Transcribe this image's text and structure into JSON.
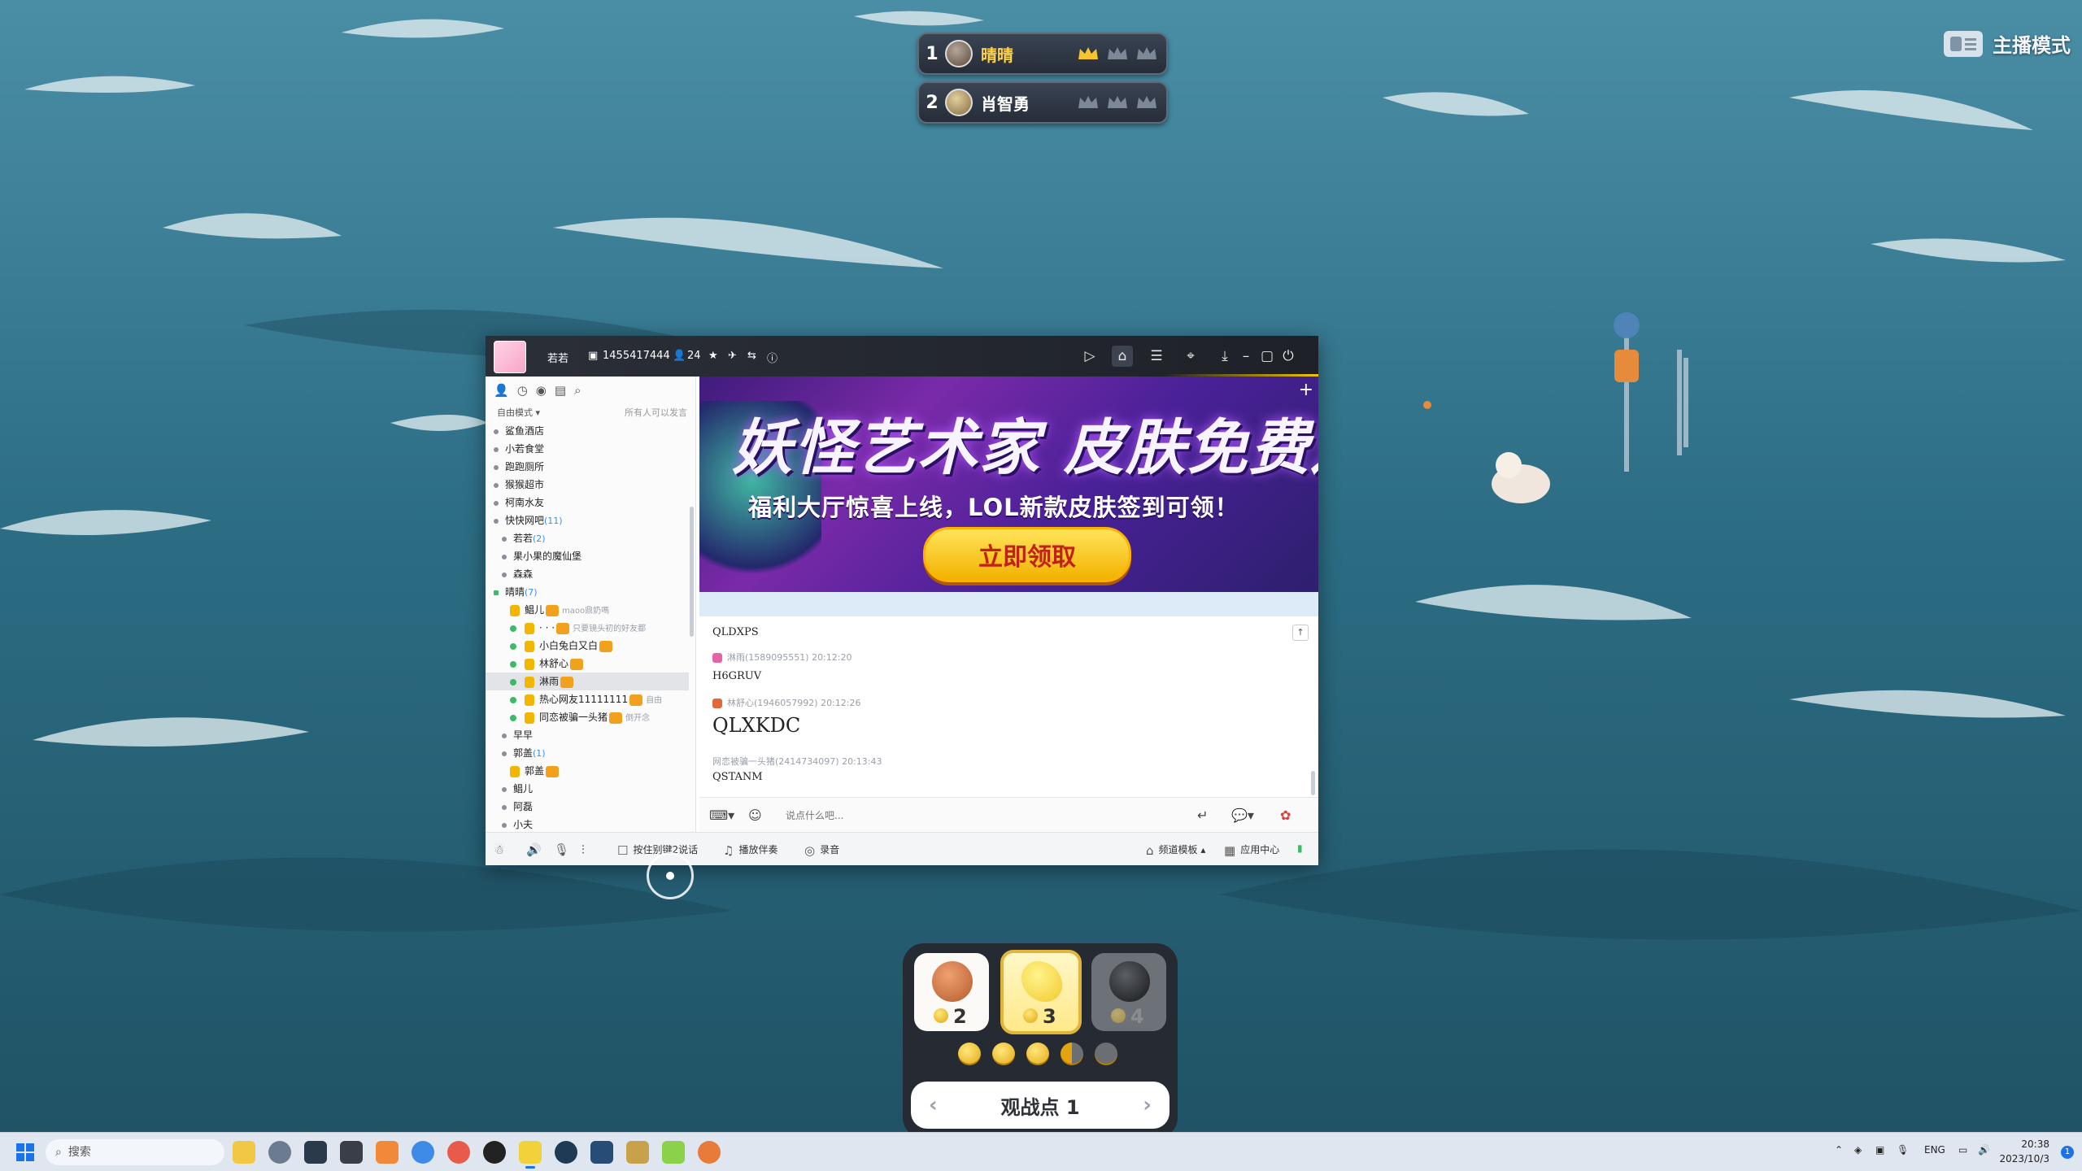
{
  "scoreboard": [
    {
      "rank": "1",
      "name": "晴晴",
      "crowns": 1
    },
    {
      "rank": "2",
      "name": "肖智勇",
      "crowns": 0
    }
  ],
  "mode_label": "主播模式",
  "yy_window": {
    "title": "若若",
    "channel_id": "1455417444",
    "online_count": "24",
    "left_panel": {
      "mode": "自由模式",
      "mode_note": "所有人可以发言",
      "tree": [
        {
          "label": "鲨鱼酒店",
          "indent": 1,
          "type": "bullet"
        },
        {
          "label": "小若食堂",
          "indent": 1,
          "type": "bullet"
        },
        {
          "label": "跑跑厕所",
          "indent": 1,
          "type": "bullet"
        },
        {
          "label": "猴猴超市",
          "indent": 1,
          "type": "bullet"
        },
        {
          "label": "柯南水友",
          "indent": 1,
          "type": "bullet"
        },
        {
          "label": "快快网吧",
          "count": "(11)",
          "indent": 1,
          "type": "bullet"
        },
        {
          "label": "若若",
          "count": "(2)",
          "indent": 2,
          "type": "bullet"
        },
        {
          "label": "果小果的魔仙堡",
          "indent": 2,
          "type": "bullet"
        },
        {
          "label": "森森",
          "indent": 2,
          "type": "bullet"
        },
        {
          "label": "晴晴",
          "count": "(7)",
          "indent": 1,
          "type": "group"
        },
        {
          "label": "鲳儿",
          "sign": "maoo鼎奶嗎",
          "indent": 3,
          "type": "user"
        },
        {
          "label": "· · ·",
          "sign": "只要镜头初的好友都",
          "indent": 3,
          "type": "user-dot"
        },
        {
          "label": "小白兔白又白",
          "indent": 3,
          "type": "user-dot"
        },
        {
          "label": "林舒心",
          "indent": 3,
          "type": "user-dot"
        },
        {
          "label": "淋雨",
          "indent": 3,
          "type": "user-dot",
          "selected": true
        },
        {
          "label": "热心网友11111111",
          "sign": "自由",
          "indent": 3,
          "type": "user-dot"
        },
        {
          "label": "同恋被骗一头猪",
          "sign": "倒开念",
          "indent": 3,
          "type": "user-dot"
        },
        {
          "label": "早早",
          "indent": 2,
          "type": "bullet"
        },
        {
          "label": "郭盖",
          "count": "(1)",
          "indent": 2,
          "type": "bullet"
        },
        {
          "label": "郭盖",
          "indent": 3,
          "type": "user"
        },
        {
          "label": "鲳儿",
          "indent": 2,
          "type": "bullet"
        },
        {
          "label": "阿磊",
          "indent": 2,
          "type": "bullet"
        },
        {
          "label": "小夫",
          "indent": 2,
          "type": "bullet"
        }
      ]
    },
    "banner": {
      "title": "妖怪艺术家 皮肤免费送",
      "subtitle": "福利大厅惊喜上线，LOL新款皮肤签到可领！",
      "button": "立即领取"
    },
    "chat": [
      {
        "head": "",
        "text": "QLDXPS",
        "size": "s"
      },
      {
        "head": "淋雨(1589095551)  20:12:20",
        "text": "H6GRUV",
        "size": "s"
      },
      {
        "head": "林舒心(1946057992)  20:12:26",
        "text": "QLXKDC",
        "size": "l"
      },
      {
        "head": "网恋被骗一头猪(2414734097)  20:13:43",
        "text": "QSTANM",
        "size": "s"
      }
    ],
    "input_placeholder": "说点什么吧...",
    "bottom_bar": {
      "ptt": "按住别键2说话",
      "music": "播放伴奏",
      "record": "录音",
      "template": "频道模板",
      "app_center": "应用中心"
    }
  },
  "game_panel": {
    "items": [
      {
        "cost": "2",
        "state": "normal",
        "color": "#d07a4b"
      },
      {
        "cost": "3",
        "state": "selected",
        "color": "#f2d13a"
      },
      {
        "cost": "4",
        "state": "dim",
        "color": "#2b2d31"
      }
    ],
    "coins": {
      "full": 3,
      "half": 1,
      "empty": 1
    },
    "view_point": "观战点 1"
  },
  "taskbar": {
    "search": "搜索",
    "lang": "ENG",
    "time": "20:38",
    "date": "2023/10/3",
    "notifications": "1"
  },
  "colors": {
    "sea_dark": "#1c4a5e",
    "sea_light": "#3f7d93",
    "gold": "#f2b200"
  }
}
